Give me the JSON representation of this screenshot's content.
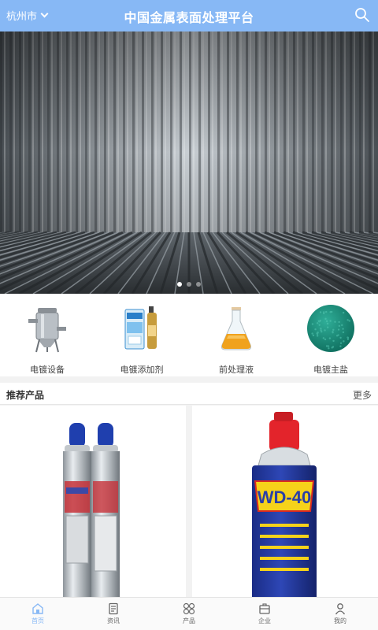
{
  "header": {
    "city": "杭州市",
    "title": "中国金属表面处理平台"
  },
  "banner": {
    "slides": 3,
    "active_index": 0
  },
  "categories": [
    {
      "label": "电镀设备",
      "icon": "filter-equipment"
    },
    {
      "label": "电镀添加剂",
      "icon": "additive-bottle"
    },
    {
      "label": "前处理液",
      "icon": "flask-liquid"
    },
    {
      "label": "电镀主盐",
      "icon": "green-salt"
    }
  ],
  "recommended": {
    "title": "推荐产品",
    "more": "更多"
  },
  "products": [
    {
      "name": "spray-cans",
      "icon": "aerosol-cans"
    },
    {
      "name": "wd40",
      "icon": "wd40-can",
      "brand_text": "WD-40"
    }
  ],
  "tabbar": {
    "active": 0,
    "items": [
      {
        "label": "首页",
        "icon": "home-icon"
      },
      {
        "label": "资讯",
        "icon": "news-icon"
      },
      {
        "label": "产品",
        "icon": "grid-icon"
      },
      {
        "label": "企业",
        "icon": "company-icon"
      },
      {
        "label": "我的",
        "icon": "user-icon"
      }
    ]
  },
  "colors": {
    "accent": "#87b8f5",
    "background": "#f2f2f2"
  }
}
